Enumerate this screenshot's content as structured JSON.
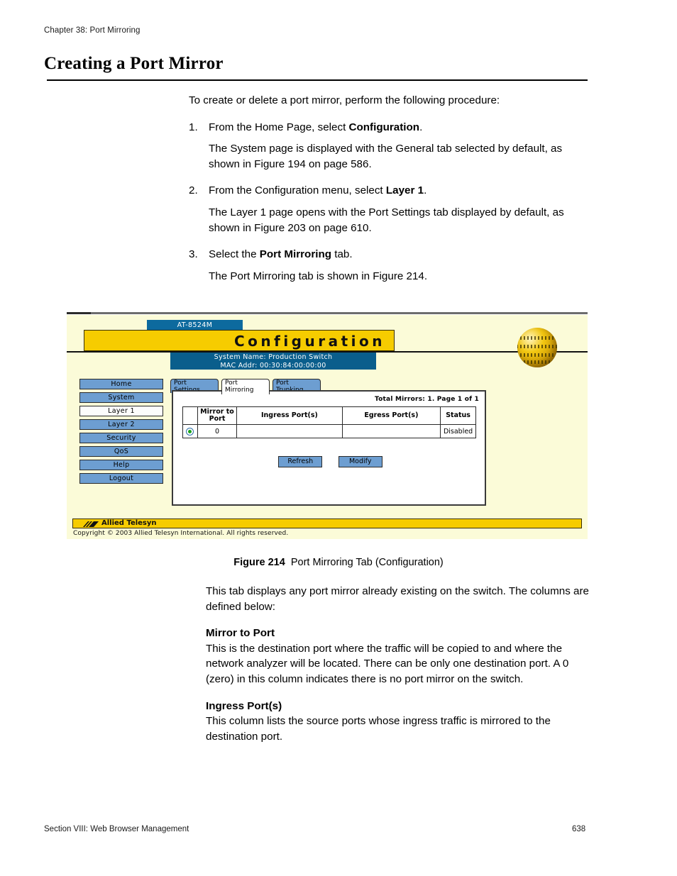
{
  "running_head": "Chapter 38: Port Mirroring",
  "page_title": "Creating a Port Mirror",
  "intro": "To create or delete a port mirror, perform the following procedure:",
  "steps": [
    {
      "num": "1.",
      "text_before": "From the Home Page, select ",
      "bold": "Configuration",
      "text_after": ".",
      "result": "The System page is displayed with the General tab selected by default, as shown in Figure 194 on page 586."
    },
    {
      "num": "2.",
      "text_before": "From the Configuration menu, select ",
      "bold": "Layer 1",
      "text_after": ".",
      "result": "The Layer 1 page opens with the Port Settings tab displayed by default, as shown in Figure 203 on page 610."
    },
    {
      "num": "3.",
      "text_before": "Select the ",
      "bold": "Port Mirroring",
      "text_after": " tab.",
      "result": "The Port Mirroring tab is shown in Figure 214."
    }
  ],
  "figure": {
    "device_tab": "AT-8524M",
    "banner_title": "Configuration",
    "system_name": "System Name: Production Switch",
    "mac_addr": "MAC Addr: 00:30:84:00:00:00",
    "sidebar": [
      {
        "label": "Home",
        "active": false
      },
      {
        "label": "System",
        "active": false
      },
      {
        "label": "Layer 1",
        "active": true
      },
      {
        "label": "Layer 2",
        "active": false
      },
      {
        "label": "Security",
        "active": false
      },
      {
        "label": "QoS",
        "active": false
      },
      {
        "label": "Help",
        "active": false
      },
      {
        "label": "Logout",
        "active": false
      }
    ],
    "tabs": [
      {
        "line1": "Port",
        "line2": "Settings",
        "active": false
      },
      {
        "line1": "Port",
        "line2": "Mirroring",
        "active": true
      },
      {
        "line1": "Port",
        "line2": "Trunking",
        "active": false
      }
    ],
    "total_line": "Total Mirrors: 1. Page 1 of 1",
    "table": {
      "headers": [
        "",
        "Mirror to Port",
        "Ingress Port(s)",
        "Egress Port(s)",
        "Status"
      ],
      "rows": [
        {
          "selected": true,
          "mirror_to_port": "0",
          "ingress_ports": "",
          "egress_ports": "",
          "status": "Disabled"
        }
      ]
    },
    "buttons": [
      {
        "label": "Refresh"
      },
      {
        "label": "Modify"
      }
    ],
    "brand": "Allied Telesyn",
    "copyright": "Copyright © 2003 Allied Telesyn International. All rights reserved.",
    "colors": {
      "gold": "#f6cc00",
      "blue_tab": "#0d6a9e",
      "blue_bar": "#0a5e8c",
      "button_blue": "#6d9ed1",
      "page_bg": "#fbfbd8"
    }
  },
  "caption": {
    "label": "Figure 214",
    "text": "Port Mirroring Tab (Configuration)"
  },
  "body2": {
    "intro": "This tab displays any port mirror already existing on the switch. The columns are defined below:",
    "sections": [
      {
        "heading": "Mirror to Port",
        "text": "This is the destination port where the traffic will be copied to and where the network analyzer will be located. There can be only one destination port. A 0 (zero) in this column indicates there is no port mirror on the switch."
      },
      {
        "heading": "Ingress Port(s)",
        "text": "This column lists the source ports whose ingress traffic is mirrored to the destination port."
      }
    ]
  },
  "page_footer": {
    "section": "Section VIII: Web Browser Management",
    "page_number": "638"
  }
}
